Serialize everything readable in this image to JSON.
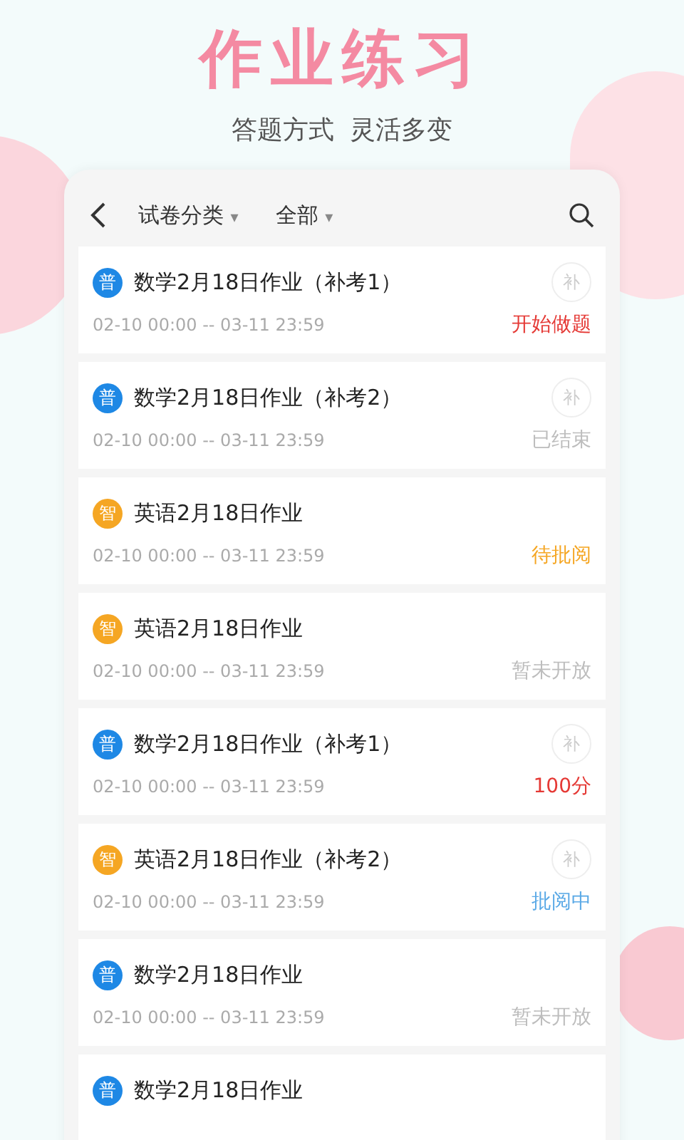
{
  "title": "作业练习",
  "subtitle": "答题方式  灵活多变",
  "toolbar": {
    "filters": [
      {
        "label": "试卷分类",
        "caret": "▾"
      },
      {
        "label": "全部",
        "caret": "▾"
      }
    ]
  },
  "items": [
    {
      "badge": {
        "text": "普",
        "color": "#1e88e5"
      },
      "title": "数学2月18日作业（补考1）",
      "makeup": "补",
      "dates": "02-10 00:00 -- 03-11 23:59",
      "status": {
        "text": "开始做题",
        "color": "#e53935"
      }
    },
    {
      "badge": {
        "text": "普",
        "color": "#1e88e5"
      },
      "title": "数学2月18日作业（补考2）",
      "makeup": "补",
      "dates": "02-10 00:00 -- 03-11 23:59",
      "status": {
        "text": "已结束",
        "color": "#bdbdbd"
      }
    },
    {
      "badge": {
        "text": "智",
        "color": "#f5a623"
      },
      "title": "英语2月18日作业",
      "dates": "02-10 00:00 -- 03-11 23:59",
      "status": {
        "text": "待批阅",
        "color": "#f5a623"
      }
    },
    {
      "badge": {
        "text": "智",
        "color": "#f5a623"
      },
      "title": "英语2月18日作业",
      "dates": "02-10 00:00 -- 03-11 23:59",
      "status": {
        "text": "暂未开放",
        "color": "#bdbdbd"
      }
    },
    {
      "badge": {
        "text": "普",
        "color": "#1e88e5"
      },
      "title": "数学2月18日作业（补考1）",
      "makeup": "补",
      "dates": "02-10 00:00 -- 03-11 23:59",
      "status": {
        "text": "100分",
        "color": "#e53935"
      }
    },
    {
      "badge": {
        "text": "智",
        "color": "#f5a623"
      },
      "title": "英语2月18日作业（补考2）",
      "makeup": "补",
      "dates": "02-10 00:00 -- 03-11 23:59",
      "status": {
        "text": "批阅中",
        "color": "#5aa9e6"
      }
    },
    {
      "badge": {
        "text": "普",
        "color": "#1e88e5"
      },
      "title": "数学2月18日作业",
      "dates": "02-10 00:00 -- 03-11 23:59",
      "status": {
        "text": "暂未开放",
        "color": "#bdbdbd"
      }
    },
    {
      "badge": {
        "text": "普",
        "color": "#1e88e5"
      },
      "title": "数学2月18日作业"
    }
  ]
}
